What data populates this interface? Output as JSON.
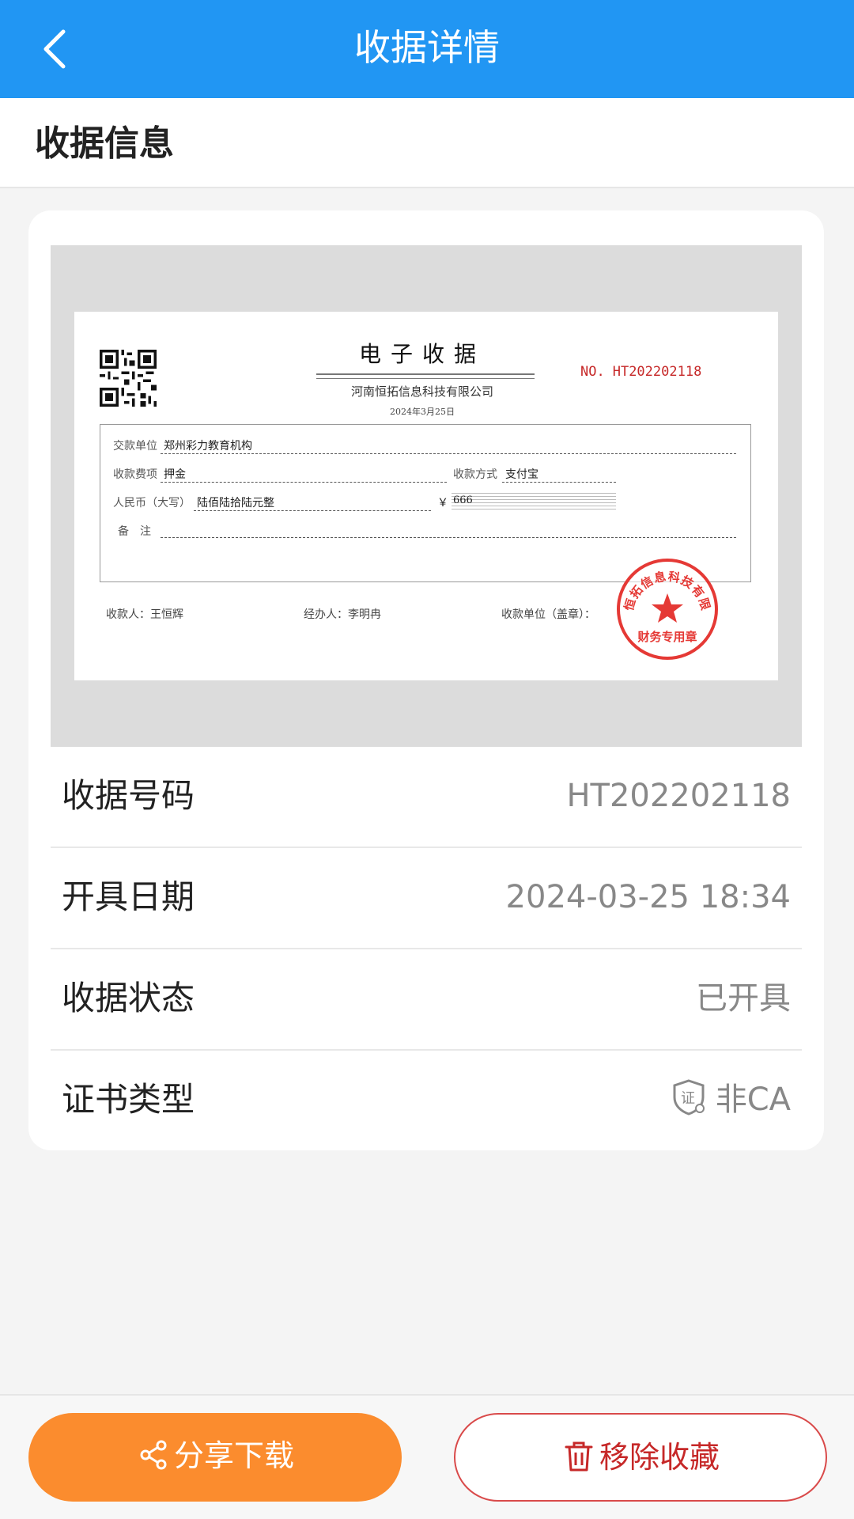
{
  "nav": {
    "title": "收据详情"
  },
  "section": {
    "title": "收据信息"
  },
  "receipt": {
    "title": "电子收据",
    "company": "河南恒拓信息科技有限公司",
    "date": "2024年3月25日",
    "no_label": "NO.",
    "no_value": "HT202202118",
    "payer_label": "交款单位",
    "payer_value": "郑州彩力教育机构",
    "item_label": "收款费项",
    "item_value": "押金",
    "method_label": "收款方式",
    "method_value": "支付宝",
    "rmb_label": "人民币（大写）",
    "rmb_value": "陆佰陆拾陆元整",
    "yen_symbol": "￥",
    "amount": "666",
    "note_label": "备　注",
    "payee": "收款人：王恒辉",
    "handler": "经办人：李明冉",
    "unit": "收款单位（盖章）：",
    "seal_center_text": "财务专用章",
    "seal_ring_text": "河南恒拓信息科技有限公司"
  },
  "details": [
    {
      "key": "收据号码",
      "value": "HT202202118"
    },
    {
      "key": "开具日期",
      "value": "2024-03-25 18:34"
    },
    {
      "key": "收据状态",
      "value": "已开具"
    },
    {
      "key": "证书类型",
      "value": "非CA",
      "icon": "certificate-shield-icon",
      "icon_text": "证"
    }
  ],
  "buttons": {
    "share_label": "分享下载",
    "remove_label": "移除收藏"
  },
  "colors": {
    "nav": "#2196f3",
    "share_button": "#fb8c2e",
    "remove_button": "#c62828",
    "seal": "#e53935"
  }
}
